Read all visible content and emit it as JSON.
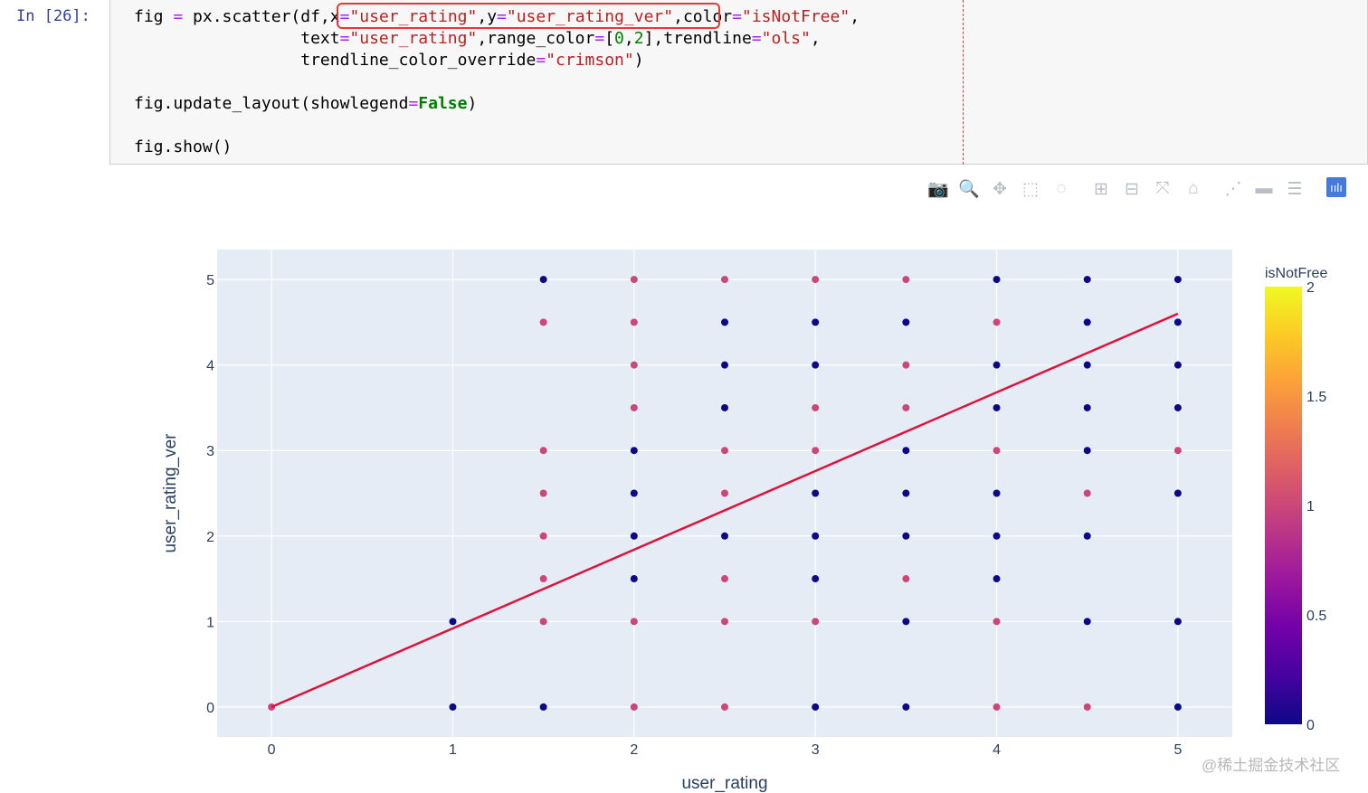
{
  "notebook": {
    "prompt": "In [26]:",
    "code": {
      "line1": [
        {
          "t": "fig ",
          "c": ""
        },
        {
          "t": "=",
          "c": "o"
        },
        {
          "t": " px.scatter(df,",
          "c": ""
        },
        {
          "t": "x",
          "c": ""
        },
        {
          "t": "=",
          "c": "o"
        },
        {
          "t": "\"user_rating\"",
          "c": "s"
        },
        {
          "t": ",",
          "c": ""
        },
        {
          "t": "y",
          "c": ""
        },
        {
          "t": "=",
          "c": "o"
        },
        {
          "t": "\"user_rating_ver\"",
          "c": "s"
        },
        {
          "t": ",",
          "c": ""
        },
        {
          "t": "color",
          "c": ""
        },
        {
          "t": "=",
          "c": "o"
        },
        {
          "t": "\"isNotFree\"",
          "c": "s"
        },
        {
          "t": ",",
          "c": ""
        }
      ],
      "line2": [
        {
          "t": "                 text",
          "c": ""
        },
        {
          "t": "=",
          "c": "o"
        },
        {
          "t": "\"user_rating\"",
          "c": "s"
        },
        {
          "t": ",range_color",
          "c": ""
        },
        {
          "t": "=",
          "c": "o"
        },
        {
          "t": "[",
          "c": ""
        },
        {
          "t": "0",
          "c": "n"
        },
        {
          "t": ",",
          "c": ""
        },
        {
          "t": "2",
          "c": "n"
        },
        {
          "t": "],trendline",
          "c": ""
        },
        {
          "t": "=",
          "c": "o"
        },
        {
          "t": "\"ols\"",
          "c": "s"
        },
        {
          "t": ",",
          "c": ""
        }
      ],
      "line3": [
        {
          "t": "                 trendline_color_override",
          "c": ""
        },
        {
          "t": "=",
          "c": "o"
        },
        {
          "t": "\"crimson\"",
          "c": "s"
        },
        {
          "t": ")",
          "c": ""
        }
      ],
      "line4": [],
      "line5": [
        {
          "t": "fig.update_layout(showlegend",
          "c": ""
        },
        {
          "t": "=",
          "c": "o"
        },
        {
          "t": "False",
          "c": "k"
        },
        {
          "t": ")",
          "c": ""
        }
      ],
      "line6": [],
      "line7": [
        {
          "t": "fig.show()",
          "c": ""
        }
      ]
    }
  },
  "toolbar": {
    "buttons": [
      {
        "name": "camera-icon",
        "glyph": "📷"
      },
      {
        "name": "zoom-icon",
        "glyph": "🔍",
        "active": true
      },
      {
        "name": "pan-icon",
        "glyph": "✥"
      },
      {
        "name": "box-select-icon",
        "glyph": "⬚"
      },
      {
        "name": "lasso-select-icon",
        "glyph": "◌"
      },
      {
        "name": "zoom-in-icon",
        "glyph": "⊞"
      },
      {
        "name": "zoom-out-icon",
        "glyph": "⊟"
      },
      {
        "name": "autoscale-icon",
        "glyph": "⤧"
      },
      {
        "name": "home-icon",
        "glyph": "⌂"
      },
      {
        "name": "spike-lines-icon",
        "glyph": "⋰"
      },
      {
        "name": "hover-closest-icon",
        "glyph": "▬"
      },
      {
        "name": "hover-compare-icon",
        "glyph": "☰"
      },
      {
        "name": "plotly-logo-icon",
        "glyph": "ıılı",
        "logo": true
      }
    ]
  },
  "chart_data": {
    "type": "scatter",
    "xlabel": "user_rating",
    "ylabel": "user_rating_ver",
    "xlim": [
      -0.3,
      5.3
    ],
    "ylim": [
      -0.35,
      5.35
    ],
    "xticks": [
      0,
      1,
      2,
      3,
      4,
      5
    ],
    "yticks": [
      0,
      1,
      2,
      3,
      4,
      5
    ],
    "grid": true,
    "colorbar": {
      "title": "isNotFree",
      "range": [
        0,
        2
      ],
      "ticks": [
        0,
        0.5,
        1,
        1.5,
        2
      ],
      "colorscale": [
        "#0d0887",
        "#46039f",
        "#7201a8",
        "#9c179e",
        "#bd3786",
        "#d8576b",
        "#ed7953",
        "#fb9f3a",
        "#fdca26",
        "#f0f921"
      ]
    },
    "colors": {
      "free": "#0d0887",
      "paid": "#cc4778",
      "trendline": "crimson",
      "plot_bg": "#e5ecf6"
    },
    "points": [
      {
        "x": 0,
        "y": 0,
        "c": 1
      },
      {
        "x": 1,
        "y": 1,
        "c": 0
      },
      {
        "x": 1,
        "y": 0,
        "c": 0
      },
      {
        "x": 1.5,
        "y": 5,
        "c": 0
      },
      {
        "x": 1.5,
        "y": 4.5,
        "c": 1
      },
      {
        "x": 1.5,
        "y": 3,
        "c": 1
      },
      {
        "x": 1.5,
        "y": 2.5,
        "c": 1
      },
      {
        "x": 1.5,
        "y": 2,
        "c": 1
      },
      {
        "x": 1.5,
        "y": 1.5,
        "c": 1
      },
      {
        "x": 1.5,
        "y": 1,
        "c": 1
      },
      {
        "x": 1.5,
        "y": 0,
        "c": 0
      },
      {
        "x": 2,
        "y": 5,
        "c": 1
      },
      {
        "x": 2,
        "y": 4.5,
        "c": 1
      },
      {
        "x": 2,
        "y": 4,
        "c": 1
      },
      {
        "x": 2,
        "y": 3.5,
        "c": 1
      },
      {
        "x": 2,
        "y": 3,
        "c": 0
      },
      {
        "x": 2,
        "y": 2.5,
        "c": 0
      },
      {
        "x": 2,
        "y": 2,
        "c": 0
      },
      {
        "x": 2,
        "y": 1.5,
        "c": 0
      },
      {
        "x": 2,
        "y": 1,
        "c": 1
      },
      {
        "x": 2,
        "y": 0,
        "c": 1
      },
      {
        "x": 2.5,
        "y": 5,
        "c": 1
      },
      {
        "x": 2.5,
        "y": 4.5,
        "c": 0
      },
      {
        "x": 2.5,
        "y": 4,
        "c": 0
      },
      {
        "x": 2.5,
        "y": 3.5,
        "c": 0
      },
      {
        "x": 2.5,
        "y": 3,
        "c": 1
      },
      {
        "x": 2.5,
        "y": 2.5,
        "c": 1
      },
      {
        "x": 2.5,
        "y": 2,
        "c": 0
      },
      {
        "x": 2.5,
        "y": 1.5,
        "c": 1
      },
      {
        "x": 2.5,
        "y": 1,
        "c": 1
      },
      {
        "x": 2.5,
        "y": 0,
        "c": 1
      },
      {
        "x": 3,
        "y": 5,
        "c": 1
      },
      {
        "x": 3,
        "y": 4.5,
        "c": 0
      },
      {
        "x": 3,
        "y": 4,
        "c": 0
      },
      {
        "x": 3,
        "y": 3.5,
        "c": 1
      },
      {
        "x": 3,
        "y": 3,
        "c": 1
      },
      {
        "x": 3,
        "y": 2.5,
        "c": 0
      },
      {
        "x": 3,
        "y": 2,
        "c": 0
      },
      {
        "x": 3,
        "y": 1.5,
        "c": 0
      },
      {
        "x": 3,
        "y": 1,
        "c": 1
      },
      {
        "x": 3,
        "y": 0,
        "c": 0
      },
      {
        "x": 3.5,
        "y": 5,
        "c": 1
      },
      {
        "x": 3.5,
        "y": 4.5,
        "c": 0
      },
      {
        "x": 3.5,
        "y": 4,
        "c": 1
      },
      {
        "x": 3.5,
        "y": 3.5,
        "c": 1
      },
      {
        "x": 3.5,
        "y": 3,
        "c": 0
      },
      {
        "x": 3.5,
        "y": 2.5,
        "c": 0
      },
      {
        "x": 3.5,
        "y": 2,
        "c": 0
      },
      {
        "x": 3.5,
        "y": 1.5,
        "c": 1
      },
      {
        "x": 3.5,
        "y": 1,
        "c": 0
      },
      {
        "x": 3.5,
        "y": 0,
        "c": 0
      },
      {
        "x": 4,
        "y": 5,
        "c": 0
      },
      {
        "x": 4,
        "y": 4.5,
        "c": 1
      },
      {
        "x": 4,
        "y": 4,
        "c": 0
      },
      {
        "x": 4,
        "y": 3.5,
        "c": 0
      },
      {
        "x": 4,
        "y": 3,
        "c": 1
      },
      {
        "x": 4,
        "y": 2.5,
        "c": 0
      },
      {
        "x": 4,
        "y": 2,
        "c": 0
      },
      {
        "x": 4,
        "y": 1.5,
        "c": 0
      },
      {
        "x": 4,
        "y": 1,
        "c": 1
      },
      {
        "x": 4,
        "y": 0,
        "c": 1
      },
      {
        "x": 4.5,
        "y": 5,
        "c": 0
      },
      {
        "x": 4.5,
        "y": 4.5,
        "c": 0
      },
      {
        "x": 4.5,
        "y": 4,
        "c": 0
      },
      {
        "x": 4.5,
        "y": 3.5,
        "c": 0
      },
      {
        "x": 4.5,
        "y": 3,
        "c": 0
      },
      {
        "x": 4.5,
        "y": 2.5,
        "c": 1
      },
      {
        "x": 4.5,
        "y": 2,
        "c": 0
      },
      {
        "x": 4.5,
        "y": 1,
        "c": 0
      },
      {
        "x": 4.5,
        "y": 0,
        "c": 1
      },
      {
        "x": 5,
        "y": 5,
        "c": 0
      },
      {
        "x": 5,
        "y": 4.5,
        "c": 0
      },
      {
        "x": 5,
        "y": 4,
        "c": 0
      },
      {
        "x": 5,
        "y": 3.5,
        "c": 0
      },
      {
        "x": 5,
        "y": 3,
        "c": 1
      },
      {
        "x": 5,
        "y": 2.5,
        "c": 0
      },
      {
        "x": 5,
        "y": 1,
        "c": 0
      },
      {
        "x": 5,
        "y": 0,
        "c": 0
      }
    ],
    "trendline": {
      "x": [
        0,
        5
      ],
      "y": [
        0,
        4.6
      ]
    }
  },
  "watermark": "@稀土掘金技术社区"
}
